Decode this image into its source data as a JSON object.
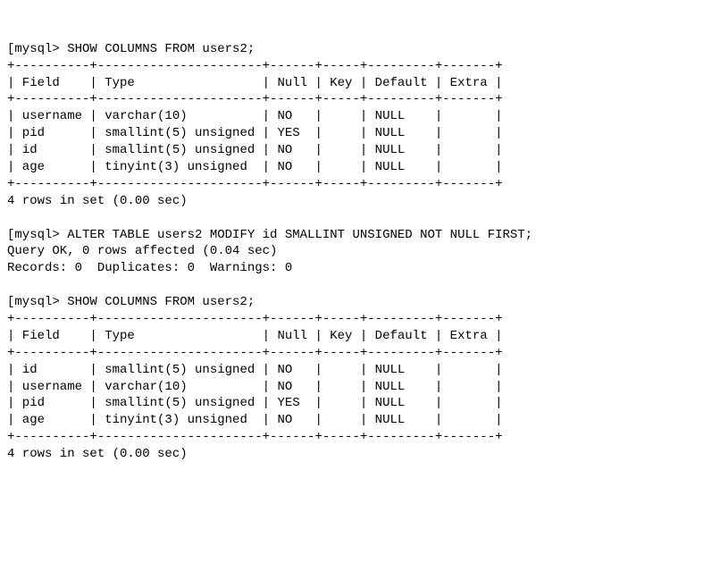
{
  "chart_data": {
    "type": "table",
    "tables": [
      {
        "command": "SHOW COLUMNS FROM users2;",
        "columns": [
          "Field",
          "Type",
          "Null",
          "Key",
          "Default",
          "Extra"
        ],
        "rows": [
          [
            "username",
            "varchar(10)",
            "NO",
            "",
            "NULL",
            ""
          ],
          [
            "pid",
            "smallint(5) unsigned",
            "YES",
            "",
            "NULL",
            ""
          ],
          [
            "id",
            "smallint(5) unsigned",
            "NO",
            "",
            "NULL",
            ""
          ],
          [
            "age",
            "tinyint(3) unsigned",
            "NO",
            "",
            "NULL",
            ""
          ]
        ],
        "summary": "4 rows in set (0.00 sec)"
      },
      {
        "command": "ALTER TABLE users2 MODIFY id SMALLINT UNSIGNED NOT NULL FIRST;",
        "result": "Query OK, 0 rows affected (0.04 sec)",
        "records": "Records: 0  Duplicates: 0  Warnings: 0"
      },
      {
        "command": "SHOW COLUMNS FROM users2;",
        "columns": [
          "Field",
          "Type",
          "Null",
          "Key",
          "Default",
          "Extra"
        ],
        "rows": [
          [
            "id",
            "smallint(5) unsigned",
            "NO",
            "",
            "NULL",
            ""
          ],
          [
            "username",
            "varchar(10)",
            "NO",
            "",
            "NULL",
            ""
          ],
          [
            "pid",
            "smallint(5) unsigned",
            "YES",
            "",
            "NULL",
            ""
          ],
          [
            "age",
            "tinyint(3) unsigned",
            "NO",
            "",
            "NULL",
            ""
          ]
        ],
        "summary": "4 rows in set (0.00 sec)"
      }
    ]
  },
  "block1": {
    "prompt_line": "[mysql> SHOW COLUMNS FROM users2;",
    "border": "+----------+----------------------+------+-----+---------+-------+",
    "header": "| Field    | Type                 | Null | Key | Default | Extra |",
    "rows": [
      "| username | varchar(10)          | NO   |     | NULL    |       |",
      "| pid      | smallint(5) unsigned | YES  |     | NULL    |       |",
      "| id       | smallint(5) unsigned | NO   |     | NULL    |       |",
      "| age      | tinyint(3) unsigned  | NO   |     | NULL    |       |"
    ],
    "summary": "4 rows in set (0.00 sec)"
  },
  "block2": {
    "prompt_line": "[mysql> ALTER TABLE users2 MODIFY id SMALLINT UNSIGNED NOT NULL FIRST;",
    "query_ok": "Query OK, 0 rows affected (0.04 sec)",
    "records": "Records: 0  Duplicates: 0  Warnings: 0"
  },
  "block3": {
    "prompt_line": "[mysql> SHOW COLUMNS FROM users2;",
    "border": "+----------+----------------------+------+-----+---------+-------+",
    "header": "| Field    | Type                 | Null | Key | Default | Extra |",
    "rows": [
      "| id       | smallint(5) unsigned | NO   |     | NULL    |       |",
      "| username | varchar(10)          | NO   |     | NULL    |       |",
      "| pid      | smallint(5) unsigned | YES  |     | NULL    |       |",
      "| age      | tinyint(3) unsigned  | NO   |     | NULL    |       |"
    ],
    "summary": "4 rows in set (0.00 sec)"
  }
}
